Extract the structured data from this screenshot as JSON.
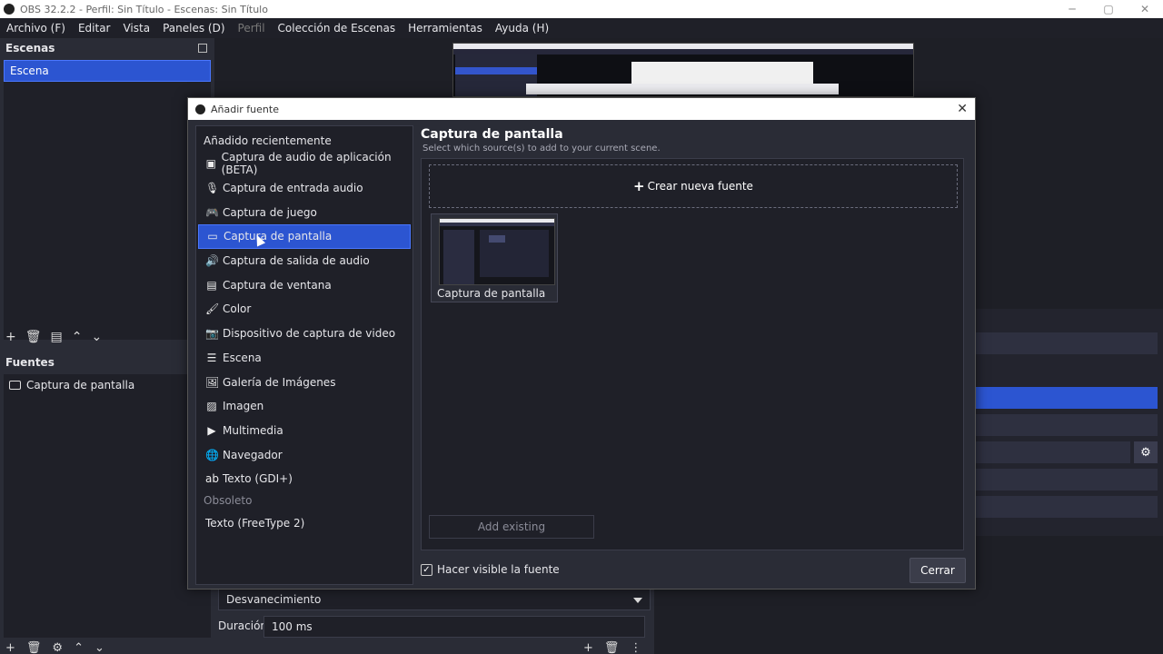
{
  "window": {
    "title": "OBS 32.2.2 - Perfil: Sin Título - Escenas: Sin Título",
    "buttons": {
      "minimize": "─",
      "maximize": "▢",
      "close": "✕"
    }
  },
  "menu": {
    "archivo": "Archivo (F)",
    "editar": "Editar",
    "vista": "Vista",
    "paneles": "Paneles (D)",
    "perfil": "Perfil",
    "coleccion": "Colección de Escenas",
    "herramientas": "Herramientas",
    "ayuda": "Ayuda (H)"
  },
  "scenes": {
    "title": "Escenas",
    "items": [
      {
        "label": "Escena"
      }
    ],
    "toolbar": {
      "add": "+",
      "remove": "🗑",
      "filters": "▤",
      "up": "⌃",
      "down": "⌄"
    }
  },
  "sources": {
    "title": "Fuentes",
    "items": [
      {
        "label": "Captura de pantalla"
      }
    ]
  },
  "transition": {
    "type": "Desvanecimiento",
    "duration_label": "Duración",
    "duration_value": "100 ms"
  },
  "dialog": {
    "title": "Añadir fuente",
    "close_glyph": "✕",
    "groups": {
      "recent": "Añadido recientemente",
      "deprecated": "Obsoleto"
    },
    "types": [
      {
        "label": "Captura de audio de aplicación (BETA)",
        "icon": "app-audio-icon",
        "glyph": "▣"
      },
      {
        "label": "Captura de entrada audio",
        "icon": "microphone-icon",
        "glyph": "🎙"
      },
      {
        "label": "Captura de juego",
        "icon": "gamepad-icon",
        "glyph": "🎮"
      },
      {
        "label": "Captura de pantalla",
        "icon": "monitor-icon",
        "glyph": "▭"
      },
      {
        "label": "Captura de salida de audio",
        "icon": "speaker-icon",
        "glyph": "🔊"
      },
      {
        "label": "Captura de ventana",
        "icon": "window-icon",
        "glyph": "▤"
      },
      {
        "label": "Color",
        "icon": "brush-icon",
        "glyph": "🖌"
      },
      {
        "label": "Dispositivo de captura de video",
        "icon": "camera-icon",
        "glyph": "📷"
      },
      {
        "label": "Escena",
        "icon": "list-icon",
        "glyph": "☰"
      },
      {
        "label": "Galería de Imágenes",
        "icon": "gallery-icon",
        "glyph": "🖼"
      },
      {
        "label": "Imagen",
        "icon": "image-icon",
        "glyph": "▨"
      },
      {
        "label": "Multimedia",
        "icon": "play-icon",
        "glyph": "▶"
      },
      {
        "label": "Navegador",
        "icon": "globe-icon",
        "glyph": "🌐"
      },
      {
        "label": "Texto (GDI+)",
        "icon": "text-icon",
        "glyph": "ab"
      }
    ],
    "deprecated_types": [
      {
        "label": "Texto (FreeType 2)"
      }
    ],
    "selected_index": 3,
    "pane": {
      "title": "Captura de pantalla",
      "subtitle": "Select which source(s) to add to your current scene.",
      "create_new": "Crear nueva fuente",
      "existing": [
        {
          "label": "Captura de pantalla"
        }
      ],
      "add_existing": "Add existing"
    },
    "make_visible": {
      "label": "Hacer visible la fuente",
      "checked": true
    },
    "close_button": "Cerrar"
  },
  "colors": {
    "accent": "#2c55d1",
    "background": "#1e1f26",
    "panel": "#2a2c36"
  }
}
